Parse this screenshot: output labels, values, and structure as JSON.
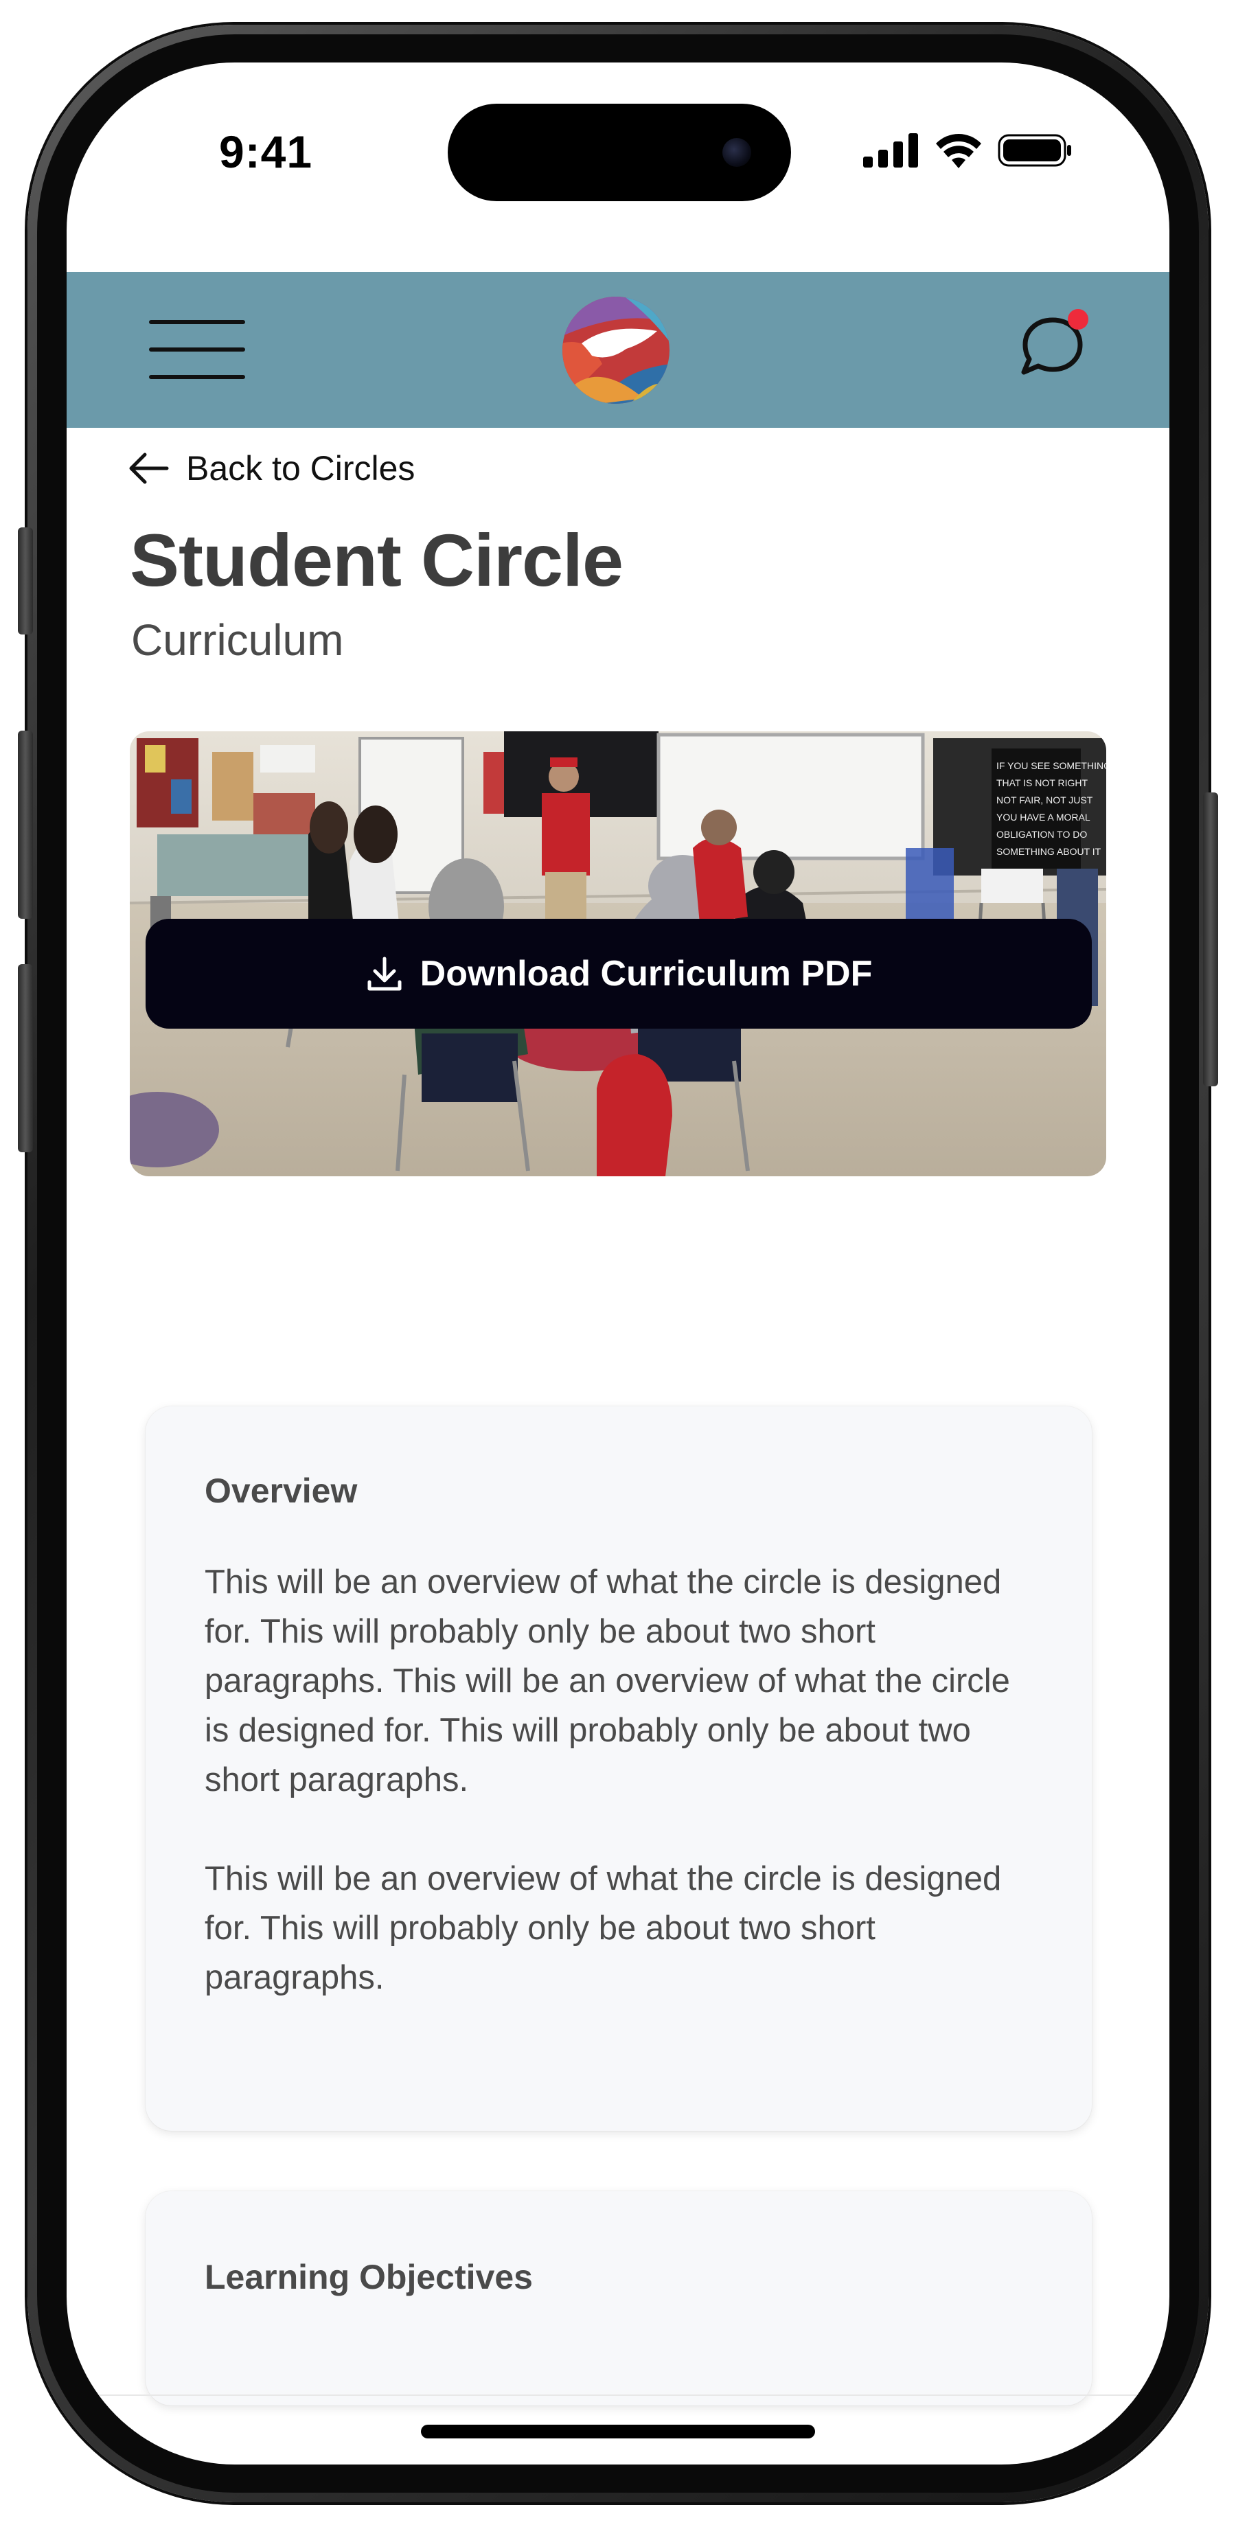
{
  "status_bar": {
    "time": "9:41",
    "icons": [
      "cellular-signal-icon",
      "wifi-icon",
      "battery-icon"
    ]
  },
  "app_bar": {
    "background_color": "#6b9aaa",
    "menu_icon": "hamburger-menu-icon",
    "logo": "app-logo",
    "chat_icon": "chat-bubble-icon",
    "notification_dot_color": "#ee2b3b"
  },
  "nav": {
    "back_label": "Back to Circles",
    "back_icon": "arrow-left-icon"
  },
  "header": {
    "title": "Student Circle",
    "subtitle": "Curriculum"
  },
  "hero_image": {
    "subject": "classroom photo of students seated in a circle of chairs around a speaker in a red vest"
  },
  "download_button": {
    "label": "Download Curriculum PDF",
    "icon": "download-icon",
    "background_color": "#050414"
  },
  "overview_card": {
    "heading": "Overview",
    "paragraphs": [
      "This will be an overview of what the circle is designed for. This will probably only be about two short paragraphs. This will be an overview of what the circle is designed for. This will probably only be about two short paragraphs.",
      "This will be an overview of what the circle is designed for. This will probably only be about two short paragraphs."
    ]
  },
  "objectives_card": {
    "heading": "Learning Objectives"
  }
}
